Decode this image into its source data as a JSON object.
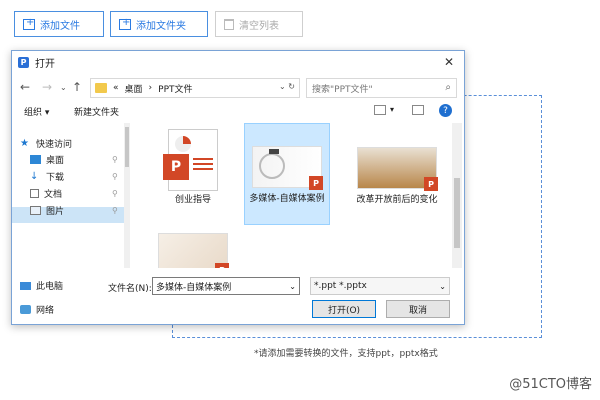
{
  "toolbar": {
    "add_file": "添加文件",
    "add_folder": "添加文件夹",
    "clear_list": "清空列表"
  },
  "hint": "*请添加需要转换的文件，支持ppt，pptx格式",
  "watermark": "@51CTO博客",
  "dialog": {
    "title": "打开",
    "logo_letter": "P",
    "close": "✕",
    "breadcrumb": [
      "«",
      "桌面",
      "›",
      "PPT文件"
    ],
    "search_placeholder": "搜索\"PPT文件\"",
    "organize": "组织 ▾",
    "new_folder": "新建文件夹",
    "help": "?",
    "nav": [
      {
        "label": "快速访问",
        "icon": "star-icon"
      },
      {
        "label": "桌面",
        "icon": "desktop-icon",
        "pin": "📌"
      },
      {
        "label": "下载",
        "icon": "download-icon",
        "pin": "📌"
      },
      {
        "label": "文档",
        "icon": "document-icon",
        "pin": "📌"
      },
      {
        "label": "图片",
        "icon": "pictures-icon",
        "pin": "📌"
      },
      {
        "label": "此电脑",
        "icon": "computer-icon"
      },
      {
        "label": "网络",
        "icon": "network-icon"
      }
    ],
    "files": [
      {
        "label": "创业指导",
        "selected": false
      },
      {
        "label": "多媒体-自媒体案例",
        "selected": true
      },
      {
        "label": "改革开放前后的变化",
        "selected": false
      },
      {
        "label": "",
        "selected": false
      }
    ],
    "filename_label": "文件名(N):",
    "filename_value": "多媒体-自媒体案例",
    "filetype": "*.ppt *.pptx",
    "open_btn": "打开(O)",
    "cancel_btn": "取消"
  }
}
